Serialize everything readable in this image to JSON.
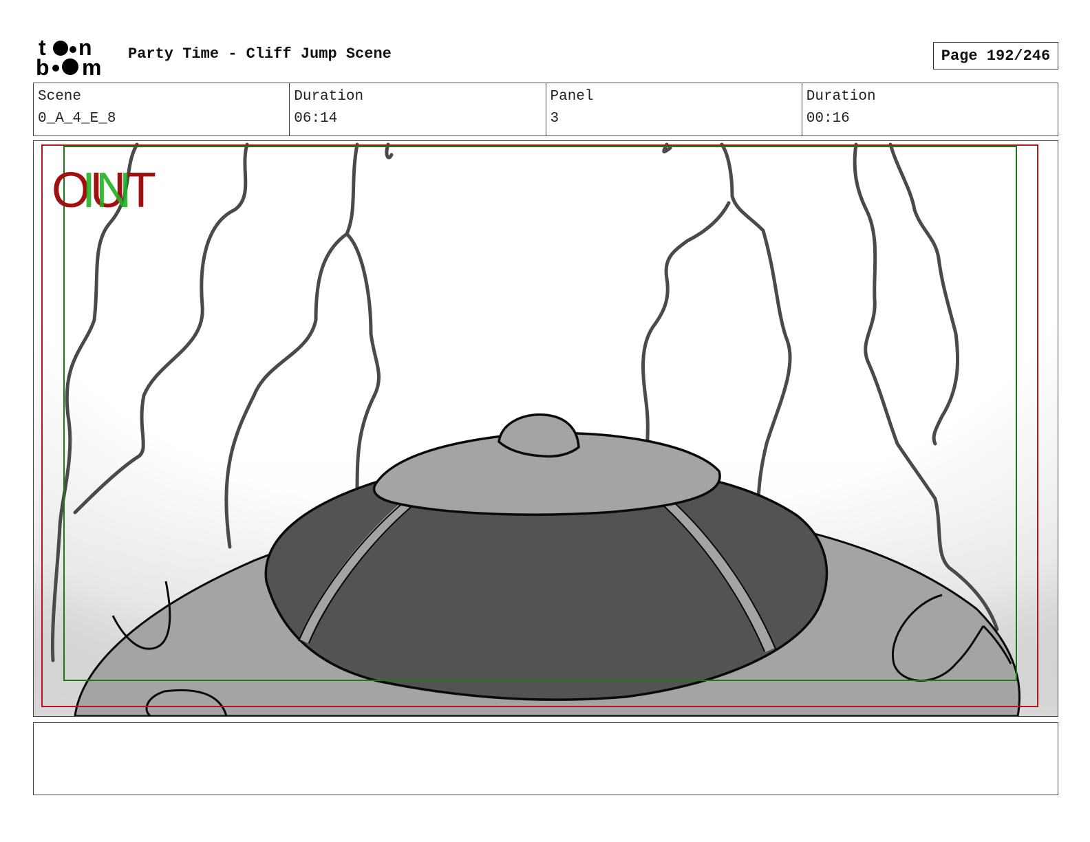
{
  "header": {
    "logo_text": "toon boom",
    "title": "Party Time - Cliff Jump Scene",
    "page_label": "Page 192/246"
  },
  "info": {
    "scene_label": "Scene",
    "scene_value": "0_A_4_E_8",
    "scene_duration_label": "Duration",
    "scene_duration_value": "06:14",
    "panel_label": "Panel",
    "panel_value": "3",
    "panel_duration_label": "Duration",
    "panel_duration_value": "00:16"
  },
  "panel": {
    "out_marker": "OUT",
    "in_marker": "IN",
    "colors": {
      "out_frame": "#b01818",
      "in_frame": "#1a7a1a",
      "out_text": "#a01010",
      "in_text": "#22b022",
      "dark_fill": "#535353",
      "mid_fill": "#a4a4a4",
      "stroke": "#0a0a0a",
      "line_grey": "#4a4a4a"
    }
  },
  "notes": {
    "text": ""
  }
}
